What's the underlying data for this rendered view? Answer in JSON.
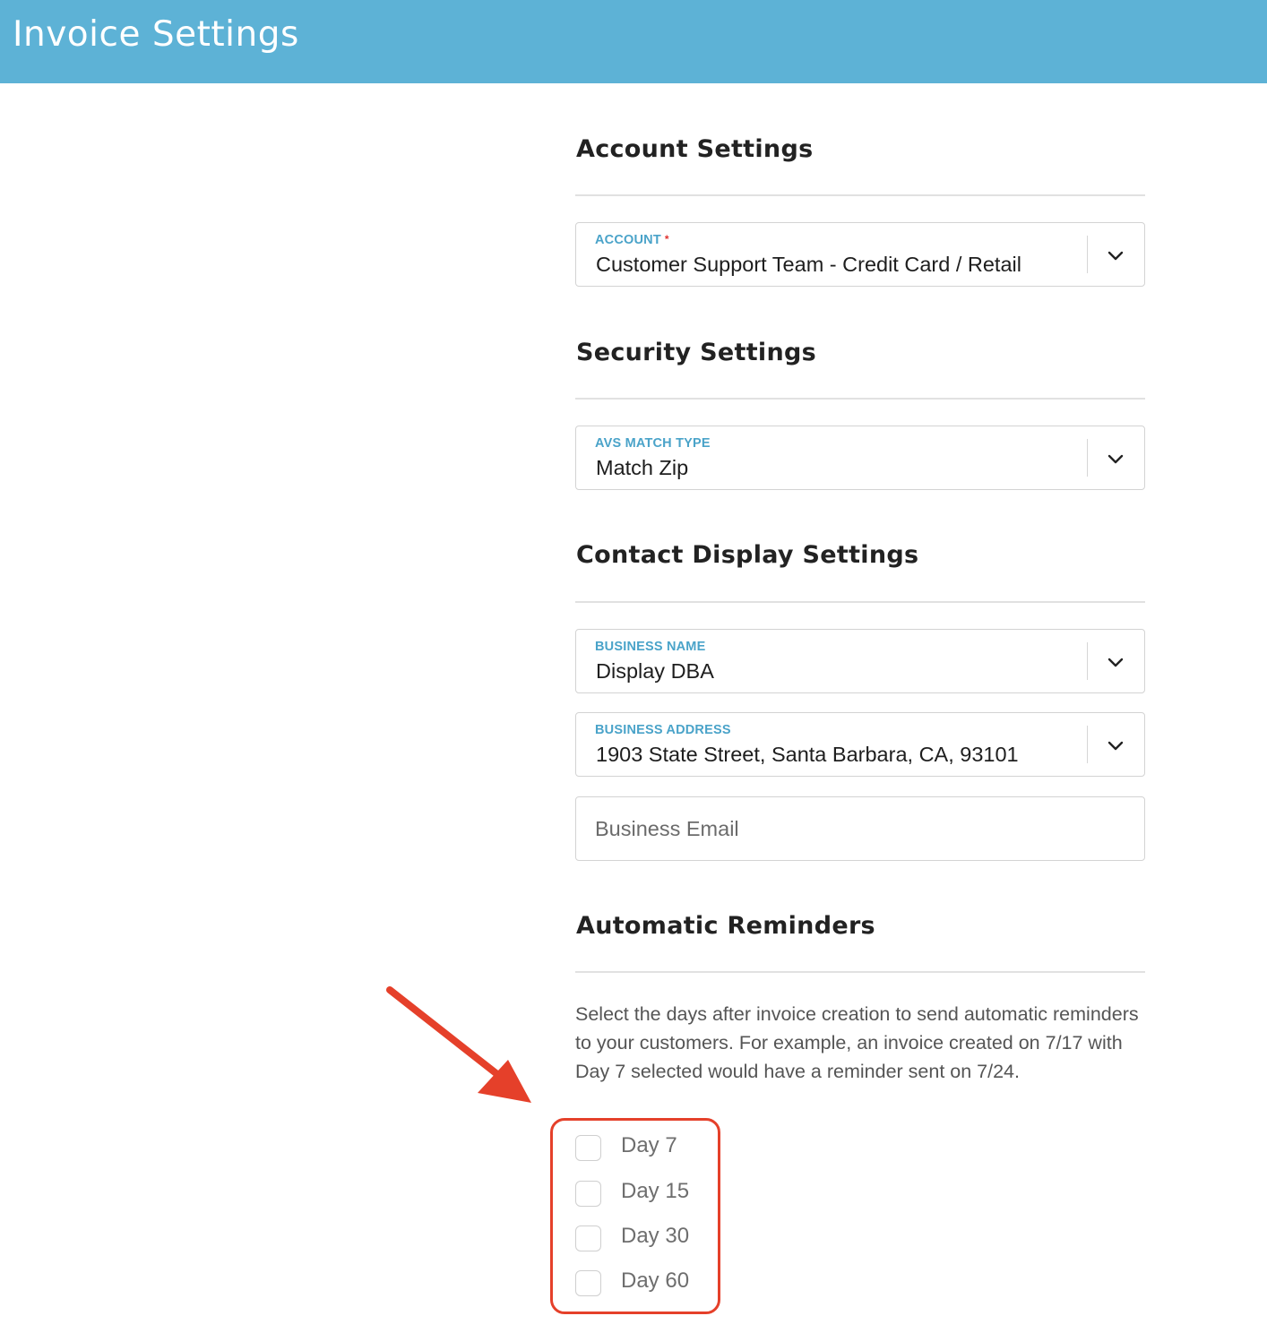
{
  "header": {
    "title": "Invoice Settings"
  },
  "sections": {
    "account": {
      "title": "Account Settings",
      "account_field": {
        "label": "ACCOUNT",
        "required_mark": "*",
        "value": "Customer Support Team - Credit Card / Retail"
      }
    },
    "security": {
      "title": "Security Settings",
      "avs_field": {
        "label": "AVS MATCH TYPE",
        "value": "Match Zip"
      }
    },
    "contact": {
      "title": "Contact Display Settings",
      "business_name": {
        "label": "BUSINESS NAME",
        "value": "Display DBA"
      },
      "business_address": {
        "label": "BUSINESS ADDRESS",
        "value": "1903 State Street, Santa Barbara, CA, 93101"
      },
      "business_email": {
        "placeholder": "Business Email",
        "value": ""
      }
    },
    "reminders": {
      "title": "Automatic Reminders",
      "description": "Select the days after invoice creation to send automatic reminders to your customers. For example, an invoice created on 7/17 with Day 7 selected would have a reminder sent on 7/24.",
      "options": [
        {
          "label": "Day 7",
          "checked": false
        },
        {
          "label": "Day 15",
          "checked": false
        },
        {
          "label": "Day 30",
          "checked": false
        },
        {
          "label": "Day 60",
          "checked": false
        }
      ]
    }
  },
  "colors": {
    "header_bg": "#5db2d6",
    "label_accent": "#4aa3c9",
    "required": "#e0322f",
    "annotation": "#e5402a"
  }
}
